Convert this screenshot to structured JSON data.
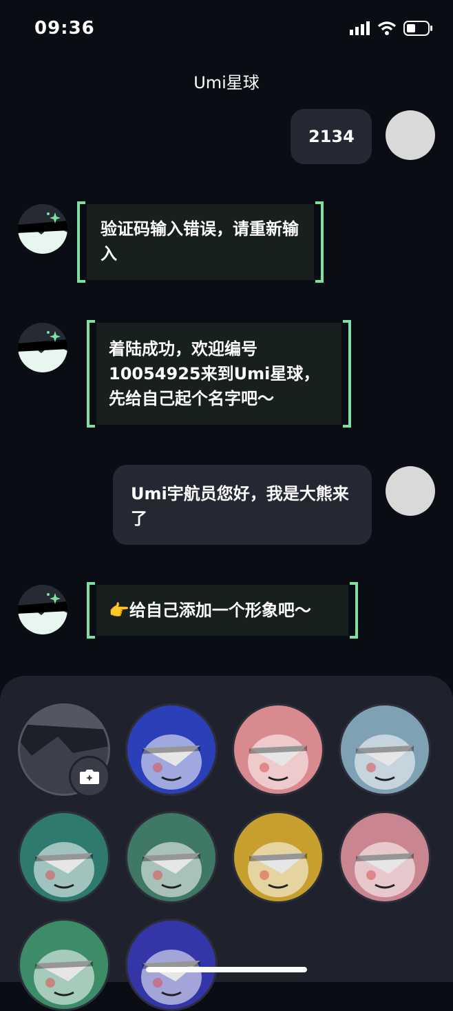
{
  "status_bar": {
    "time": "09:36"
  },
  "header": {
    "title": "Umi星球"
  },
  "messages": [
    {
      "from": "user",
      "text": "2134"
    },
    {
      "from": "bot",
      "text": "验证码输入错误，请重新输入"
    },
    {
      "from": "bot",
      "text": "着陆成功，欢迎编号10054925来到Umi星球，先给自己起个名字吧～"
    },
    {
      "from": "user",
      "text": "Umi宇航员您好，我是大熊来了"
    },
    {
      "from": "bot",
      "text": "👉给自己添加一个形象吧～"
    }
  ],
  "avatar_picker": {
    "upload_icon": "camera-icon",
    "options": [
      {
        "bg": "#2a3fb8"
      },
      {
        "bg": "#d98a8e"
      },
      {
        "bg": "#7fa1b4"
      },
      {
        "bg": "#2f7a6e"
      },
      {
        "bg": "#3f7864"
      },
      {
        "bg": "#c69f2e"
      },
      {
        "bg": "#c98690"
      },
      {
        "bg": "#3c8c68"
      },
      {
        "bg": "#3436a8"
      }
    ]
  },
  "colors": {
    "accent": "#7fe0a4",
    "background": "#0a0d14",
    "panel": "#1f222c",
    "user_bubble": "#252833",
    "bot_bubble": "#18201f"
  }
}
